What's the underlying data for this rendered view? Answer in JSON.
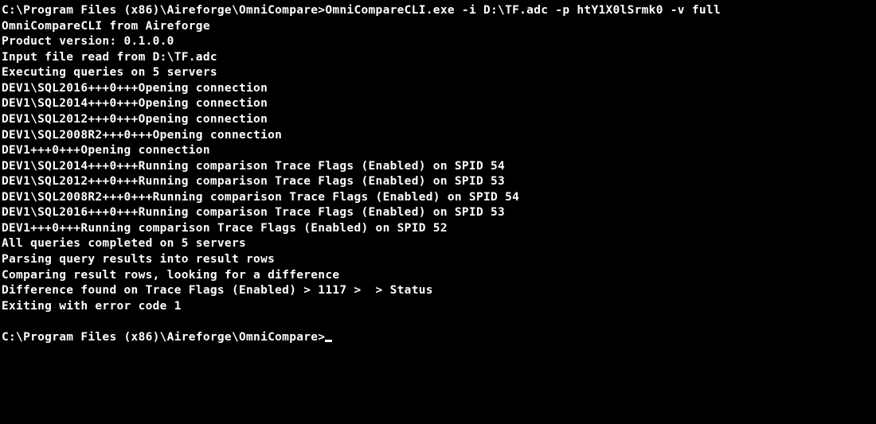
{
  "terminal": {
    "initial_prompt": "C:\\Program Files (x86)\\Aireforge\\OmniCompare>",
    "command": "OmniCompareCLI.exe -i D:\\TF.adc -p htY1X0lSrmk0 -v full",
    "output_lines": [
      "OmniCompareCLI from Aireforge",
      "Product version: 0.1.0.0",
      "Input file read from D:\\TF.adc",
      "Executing queries on 5 servers",
      "DEV1\\SQL2016+++0+++Opening connection",
      "DEV1\\SQL2014+++0+++Opening connection",
      "DEV1\\SQL2012+++0+++Opening connection",
      "DEV1\\SQL2008R2+++0+++Opening connection",
      "DEV1+++0+++Opening connection",
      "DEV1\\SQL2014+++0+++Running comparison Trace Flags (Enabled) on SPID 54",
      "DEV1\\SQL2012+++0+++Running comparison Trace Flags (Enabled) on SPID 53",
      "DEV1\\SQL2008R2+++0+++Running comparison Trace Flags (Enabled) on SPID 54",
      "DEV1\\SQL2016+++0+++Running comparison Trace Flags (Enabled) on SPID 53",
      "DEV1+++0+++Running comparison Trace Flags (Enabled) on SPID 52",
      "All queries completed on 5 servers",
      "Parsing query results into result rows",
      "Comparing result rows, looking for a difference",
      "Difference found on Trace Flags (Enabled) > 1117 >  > Status",
      "Exiting with error code 1"
    ],
    "final_prompt": "C:\\Program Files (x86)\\Aireforge\\OmniCompare>"
  }
}
